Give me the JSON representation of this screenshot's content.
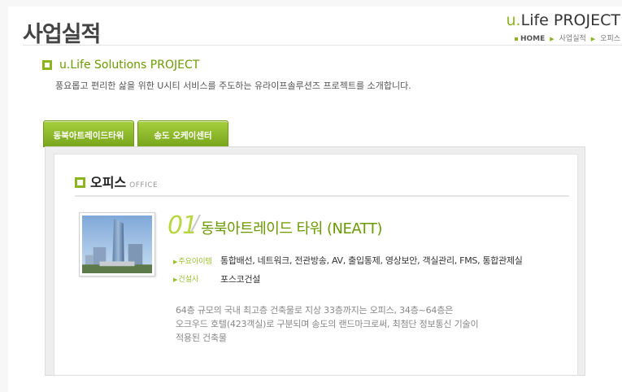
{
  "page": {
    "title": "사업실적",
    "brand_u": "u.",
    "brand_rest": "Life PROJECT",
    "breadcrumb": [
      "HOME",
      "사업실적",
      "오피스"
    ]
  },
  "section": {
    "title": "u.Life Solutions PROJECT",
    "description": "풍요롭고 편리한 삶을 위한 U시티 서비스를 주도하는 유라이프솔루션즈 프로젝트를 소개합니다."
  },
  "tabs": [
    {
      "label": "동북아트레이드타워"
    },
    {
      "label": "송도 오케이센터"
    }
  ],
  "panel": {
    "heading": "오피스",
    "heading_sub": "OFFICE",
    "project": {
      "number": "01",
      "name": "동북아트레이드 타워 (NEATT)",
      "items_label": "주요아이템",
      "items": "통합배선, 네트워크, 전관방송, AV, 출입통제, 영상보안, 객실관리, FMS, 통합관제실",
      "builder_label": "건설사",
      "builder": "포스코건설",
      "description": [
        "64층 규모의 국내 최고층 건축물로 지상 33층까지는 오피스, 34층~64층은",
        "오크우드 호텔(423객실)로 구분되며 송도의 랜드마크로써, 최첨단 정보통신 기술이",
        "적용된 건축물"
      ]
    }
  },
  "colors": {
    "accent": "#8cb321",
    "accent_dark": "#6a9a00",
    "number": "#b8d640"
  }
}
